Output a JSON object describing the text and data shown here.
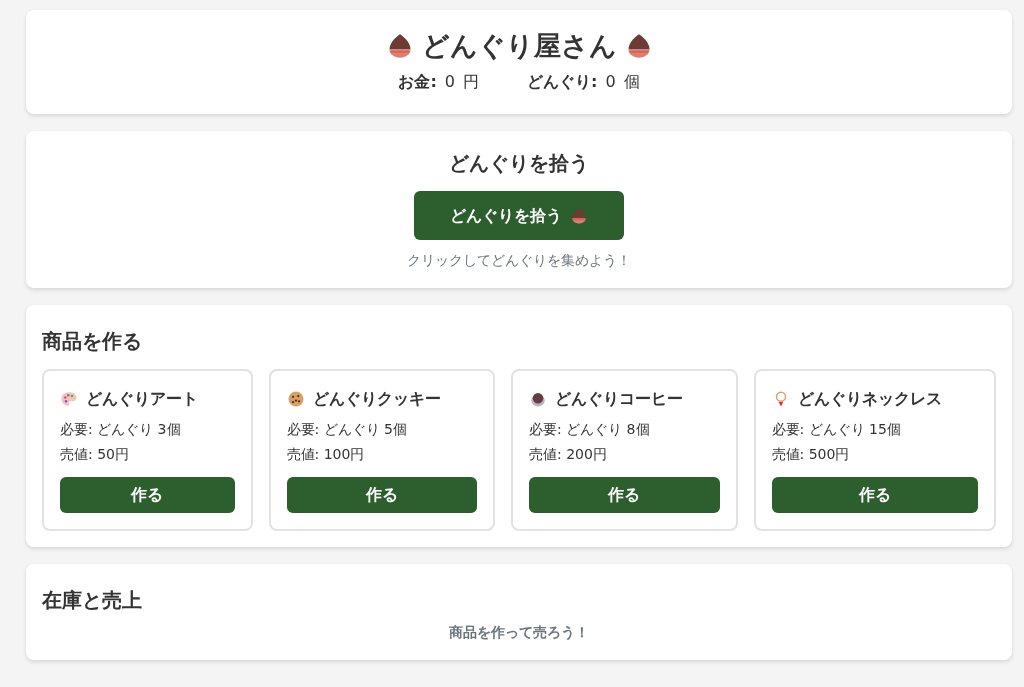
{
  "header": {
    "title": "どんぐり屋さん",
    "stats": [
      {
        "label": "お金:",
        "value": "0",
        "unit": "円"
      },
      {
        "label": "どんぐり:",
        "value": "0",
        "unit": "個"
      }
    ]
  },
  "gather": {
    "heading": "どんぐりを拾う",
    "button": "どんぐりを拾う",
    "hint": "クリックしてどんぐりを集めよう！"
  },
  "craft": {
    "heading": "商品を作る",
    "products": [
      {
        "name": "どんぐりアート",
        "need": "必要: どんぐり 3個",
        "price": "売値: 50円",
        "button": "作る"
      },
      {
        "name": "どんぐりクッキー",
        "need": "必要: どんぐり 5個",
        "price": "売値: 100円",
        "button": "作る"
      },
      {
        "name": "どんぐりコーヒー",
        "need": "必要: どんぐり 8個",
        "price": "売値: 200円",
        "button": "作る"
      },
      {
        "name": "どんぐりネックレス",
        "need": "必要: どんぐり 15個",
        "price": "売値: 500円",
        "button": "作る"
      }
    ]
  },
  "inventory": {
    "heading": "在庫と売上",
    "empty": "商品を作って売ろう！"
  }
}
